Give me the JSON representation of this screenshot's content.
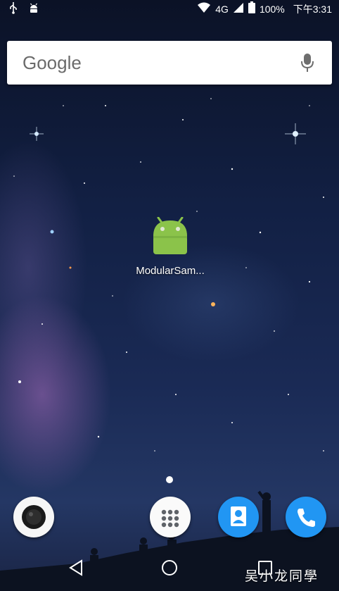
{
  "status_bar": {
    "left_icons": [
      "usb-icon",
      "android-debug-icon"
    ],
    "network": "4G",
    "battery": "100%",
    "time": "下午3:31",
    "right_icons": [
      "wifi-icon",
      "signal-icon",
      "battery-icon"
    ]
  },
  "search": {
    "label": "Google",
    "icon": "mic-icon"
  },
  "home": {
    "apps": [
      {
        "label": "ModularSam...",
        "icon": "android-app-icon"
      }
    ]
  },
  "dock": {
    "items": [
      {
        "icon": "camera-icon"
      },
      {
        "icon": "app-drawer-icon"
      },
      {
        "icon": "contacts-icon"
      },
      {
        "icon": "phone-icon"
      }
    ]
  },
  "navbar": {
    "buttons": [
      "back-icon",
      "home-icon",
      "recents-icon"
    ]
  },
  "watermark": "吴小龙同學",
  "colors": {
    "accent_blue": "#2196f3",
    "android_green": "#8bc34a"
  }
}
